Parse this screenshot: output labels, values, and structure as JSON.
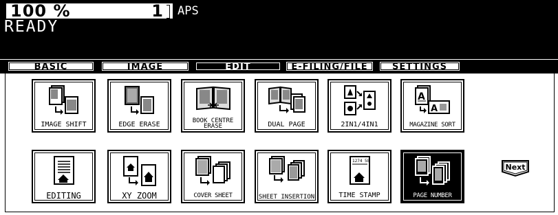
{
  "status_bar": {
    "zoom": "100  %",
    "copies": "1",
    "paper_mode": "APS",
    "status": "READY"
  },
  "tabs": [
    {
      "label": "BASIC",
      "active": false
    },
    {
      "label": "IMAGE",
      "active": false
    },
    {
      "label": "EDIT",
      "active": true
    },
    {
      "label": "E-FILING/FILE",
      "active": false
    },
    {
      "label": "SETTINGS",
      "active": false
    }
  ],
  "functions": [
    {
      "label": "IMAGE SHIFT",
      "icon": "image-shift-icon"
    },
    {
      "label": "EDGE ERASE",
      "icon": "edge-erase-icon"
    },
    {
      "label": "BOOK CENTRE ERASE",
      "icon": "book-centre-erase-icon"
    },
    {
      "label": "DUAL PAGE",
      "icon": "dual-page-icon"
    },
    {
      "label": "2IN1/4IN1",
      "icon": "2in1-4in1-icon"
    },
    {
      "label": "MAGAZINE SORT",
      "icon": "magazine-sort-icon"
    },
    {
      "label": "EDITING",
      "icon": "editing-icon"
    },
    {
      "label": "XY ZOOM",
      "icon": "xy-zoom-icon"
    },
    {
      "label": "COVER SHEET",
      "icon": "cover-sheet-icon"
    },
    {
      "label": "SHEET INSERTION",
      "icon": "sheet-insertion-icon"
    },
    {
      "label": "TIME STAMP",
      "icon": "time-stamp-icon"
    },
    {
      "label": "PAGE NUMBER",
      "icon": "page-number-icon",
      "active": true
    }
  ],
  "next_label": "Next"
}
